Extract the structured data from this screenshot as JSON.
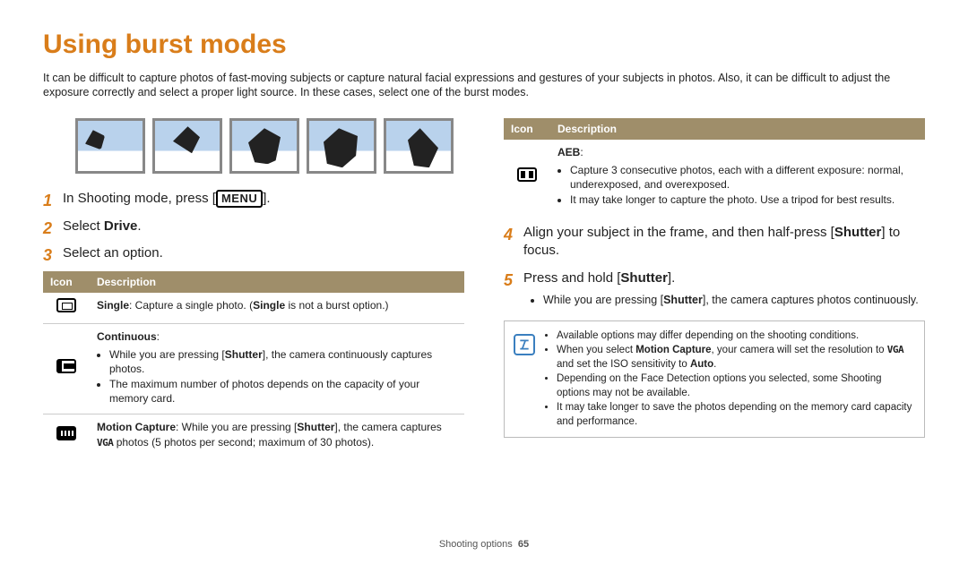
{
  "title": "Using burst modes",
  "intro": "It can be difficult to capture photos of fast-moving subjects or capture natural facial expressions and gestures of your subjects in photos. Also, it can be difficult to adjust the exposure correctly and select a proper light source. In these cases, select one of the burst modes.",
  "left": {
    "steps": {
      "s1_pre": "In Shooting mode, press [",
      "s1_badge": "MENU",
      "s1_post": "].",
      "s2_pre": "Select ",
      "s2_bold": "Drive",
      "s2_post": ".",
      "s3": "Select an option."
    },
    "table": {
      "h_icon": "Icon",
      "h_desc": "Description",
      "row1": {
        "bold": "Single",
        "pre": ": Capture a single photo. (",
        "mid_bold": "Single",
        "post": " is not a burst option.)"
      },
      "row2": {
        "title": "Continuous",
        "b1_pre": "While you are pressing [",
        "b1_bold": "Shutter",
        "b1_post": "], the camera continuously captures photos.",
        "b2": "The maximum number of photos depends on the capacity of your memory card."
      },
      "row3": {
        "bold": "Motion Capture",
        "pre": ": While you are pressing [",
        "mid_bold": "Shutter",
        "post1": "], the camera captures ",
        "vga": "VGA",
        "post2": " photos (5 photos per second; maximum of 30 photos)."
      }
    }
  },
  "right": {
    "table": {
      "h_icon": "Icon",
      "h_desc": "Description",
      "row1": {
        "title": "AEB",
        "b1": "Capture 3 consecutive photos, each with a different exposure: normal, underexposed, and overexposed.",
        "b2": "It may take longer to capture the photo. Use a tripod for best results."
      }
    },
    "steps": {
      "s4_pre": "Align your subject in the frame, and then half-press [",
      "s4_bold": "Shutter",
      "s4_post": "] to focus.",
      "s5_pre": "Press and hold [",
      "s5_bold": "Shutter",
      "s5_post": "].",
      "s5_sub_pre": "While you are pressing [",
      "s5_sub_bold": "Shutter",
      "s5_sub_post": "], the camera captures photos continuously."
    },
    "note": {
      "n1": "Available options may differ depending on the shooting conditions.",
      "n2_pre": "When you select ",
      "n2_bold": "Motion Capture",
      "n2_mid": ", your camera will set the resolution to ",
      "n2_vga": "VGA",
      "n2_post": " and set the ISO sensitivity to ",
      "n2_bold2": "Auto",
      "n2_end": ".",
      "n3": "Depending on the Face Detection options you selected, some Shooting options may not be available.",
      "n4": "It may take longer to save the photos depending on the memory card capacity and performance."
    }
  },
  "footer": {
    "section": "Shooting options",
    "page": "65"
  }
}
